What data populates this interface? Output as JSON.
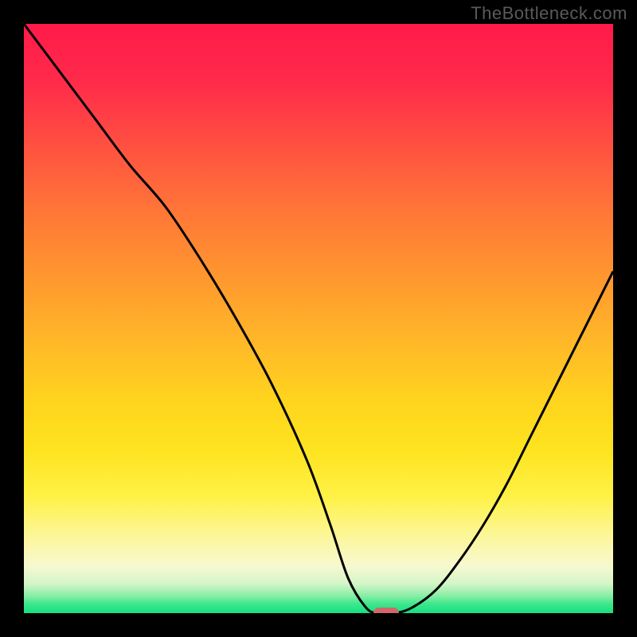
{
  "watermark": "TheBottleneck.com",
  "colors": {
    "frame_bg": "#000000",
    "curve": "#000000",
    "marker": "#d06868",
    "gradient_top": "#ff1a4a",
    "gradient_mid": "#ffd41e",
    "gradient_bottom": "#15e082"
  },
  "chart_data": {
    "type": "line",
    "title": "",
    "xlabel": "",
    "ylabel": "",
    "xlim": [
      0,
      100
    ],
    "ylim": [
      0,
      100
    ],
    "grid": false,
    "series": [
      {
        "name": "bottleneck-curve",
        "x": [
          0,
          6,
          12,
          18,
          24,
          30,
          36,
          42,
          48,
          52,
          55,
          58,
          60,
          63,
          66,
          70,
          74,
          78,
          82,
          86,
          90,
          94,
          98,
          100
        ],
        "y": [
          100,
          92,
          84,
          76,
          69,
          60,
          50,
          39,
          26,
          15,
          6,
          1,
          0,
          0,
          1,
          4,
          9,
          15,
          22,
          30,
          38,
          46,
          54,
          58
        ]
      }
    ],
    "annotations": [
      {
        "name": "optimal-marker",
        "x": 61.5,
        "y": 0
      }
    ],
    "background_gradient": {
      "orientation": "vertical",
      "stops": [
        {
          "pos": 0.0,
          "color": "#ff1a4a"
        },
        {
          "pos": 0.5,
          "color": "#ffb828"
        },
        {
          "pos": 0.8,
          "color": "#fff144"
        },
        {
          "pos": 0.95,
          "color": "#d4f6c8"
        },
        {
          "pos": 1.0,
          "color": "#15e082"
        }
      ]
    }
  }
}
